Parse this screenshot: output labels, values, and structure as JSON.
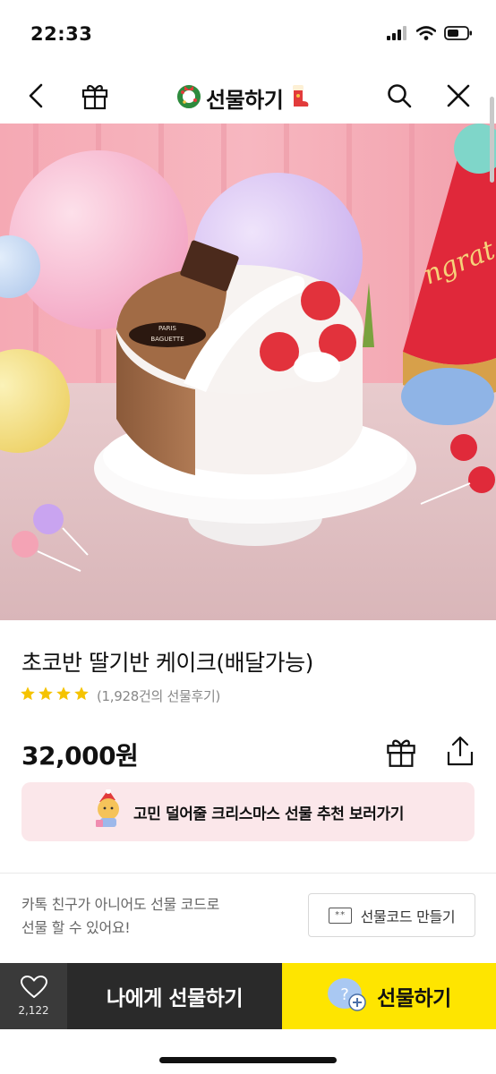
{
  "status_bar": {
    "time": "22:33"
  },
  "nav": {
    "title": "선물하기",
    "icons": [
      "back-arrow-icon",
      "gift-box-icon",
      "wreath-icon",
      "santa-boot-icon",
      "search-icon",
      "close-icon"
    ]
  },
  "hero": {
    "brand_plaque": [
      "PARIS",
      "BAGUETTE"
    ],
    "hat_text": "ngrat"
  },
  "product": {
    "title": "초코반 딸기반 케이크(배달가능)",
    "rating_stars": 4,
    "review_text": "(1,928건의 선물후기)",
    "price": "32,000원"
  },
  "banner": {
    "text": "고민 덜어줄 크리스마스 선물 추천 보러가기"
  },
  "gift_code": {
    "description_line1": "카톡 친구가 아니어도 선물 코드로",
    "description_line2": "선물 할 수 있어요!",
    "button_icon_text": "**",
    "button_label": "선물코드 만들기"
  },
  "bottom_bar": {
    "like_count": "2,122",
    "gift_self_label": "나에게 선물하기",
    "gift_label": "선물하기"
  },
  "colors": {
    "kakao_yellow": "#fee500",
    "banner_pink": "#fbe7ea",
    "star": "#f5c300",
    "dark_bar": "#2a2a2a"
  }
}
